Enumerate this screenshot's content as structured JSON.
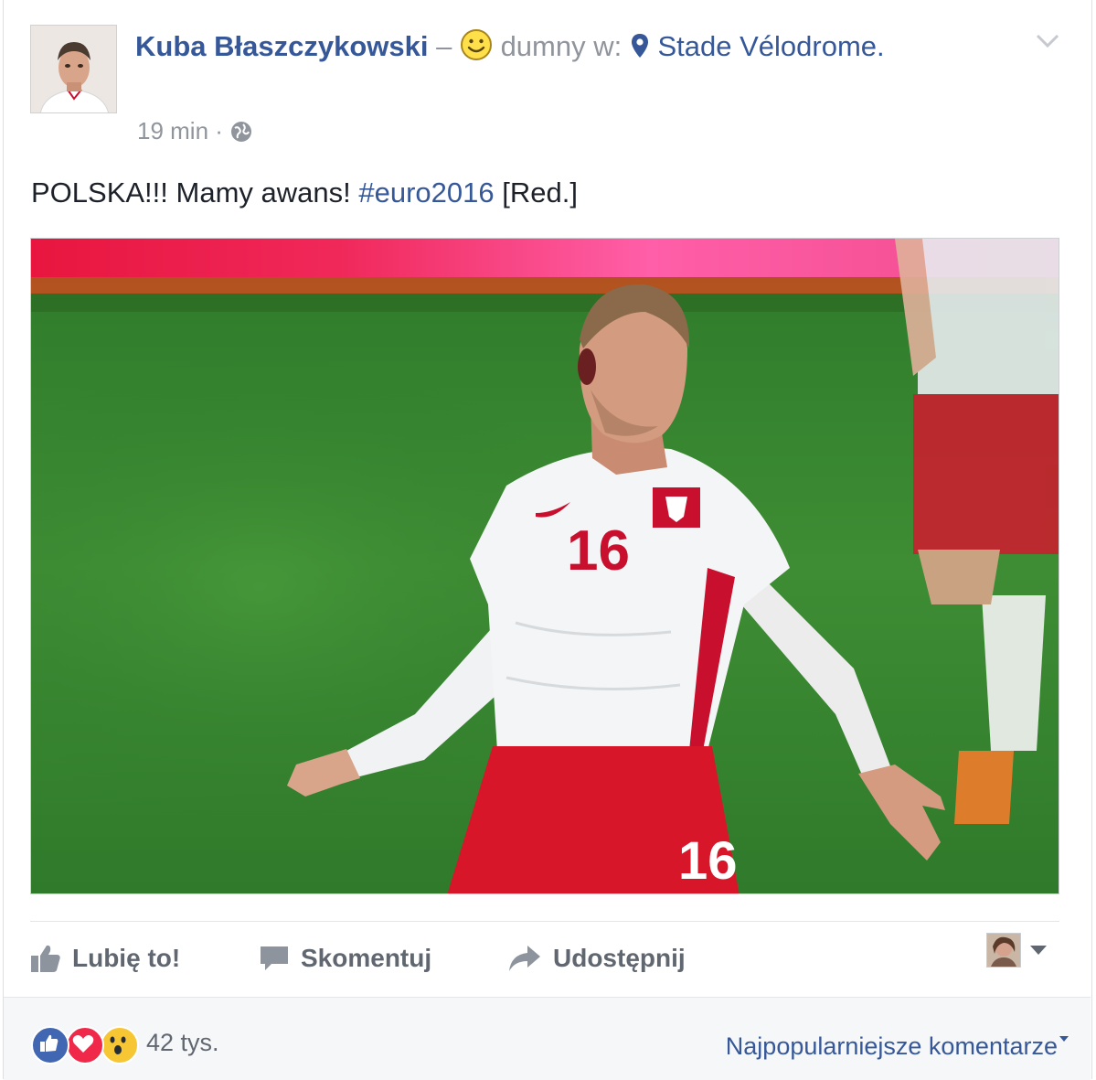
{
  "post": {
    "author": "Kuba Błaszczykowski",
    "dash": " – ",
    "feeling": "dumny",
    "at_word": " w: ",
    "place": "Stade Vélodrome.",
    "time": "19 min",
    "separator": " · ",
    "text_main": "POLSKA!!! Mamy awans! ",
    "hashtag": "#euro2016",
    "text_end": " [Red.]",
    "photo_shirt_number": "16",
    "photo_shorts_number": "16"
  },
  "actions": {
    "like": "Lubię to!",
    "comment": "Skomentuj",
    "share": "Udostępnij"
  },
  "footer": {
    "reaction_count": "42 tys.",
    "sort_label": "Najpopularniejsze komentarze"
  },
  "colors": {
    "link": "#365899",
    "meta": "#90949c",
    "like_blue": "#4267b2",
    "love_red": "#f0284a",
    "wow_yellow": "#f7c635",
    "pitch_green": "#3f8a2e"
  },
  "icons": [
    "smiley-icon",
    "location-pin-icon",
    "globe-icon",
    "chevron-down-icon",
    "thumbs-up-icon",
    "comment-icon",
    "share-arrow-icon",
    "like-reaction-icon",
    "love-reaction-icon",
    "wow-reaction-icon",
    "caret-down-icon"
  ]
}
